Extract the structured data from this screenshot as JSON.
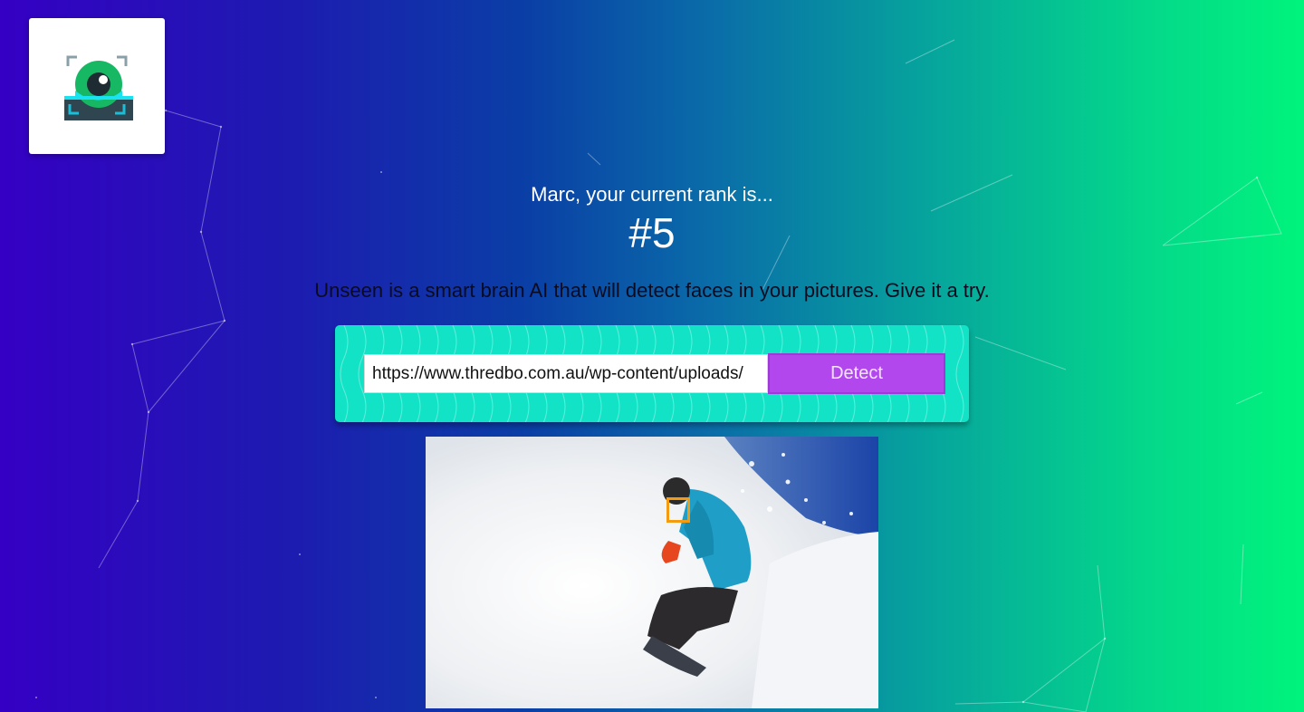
{
  "app": {
    "logo_icon": "eye-scanner-icon"
  },
  "hero": {
    "greeting": "Marc, your current rank is...",
    "rank": "#5",
    "tagline": "Unseen is a smart brain AI that will detect faces in your pictures. Give it a try."
  },
  "form": {
    "url_value": "https://www.thredbo.com.au/wp-content/uploads/",
    "button_label": "Detect"
  },
  "result": {
    "faces_detected": 1,
    "image_icon": "snowboarder-photo"
  },
  "colors": {
    "accent_button": "#b347ee",
    "panel": "#12e3c6",
    "face_box": "#f39c12",
    "gradient_start": "#3500c4",
    "gradient_end": "#00f47c"
  }
}
